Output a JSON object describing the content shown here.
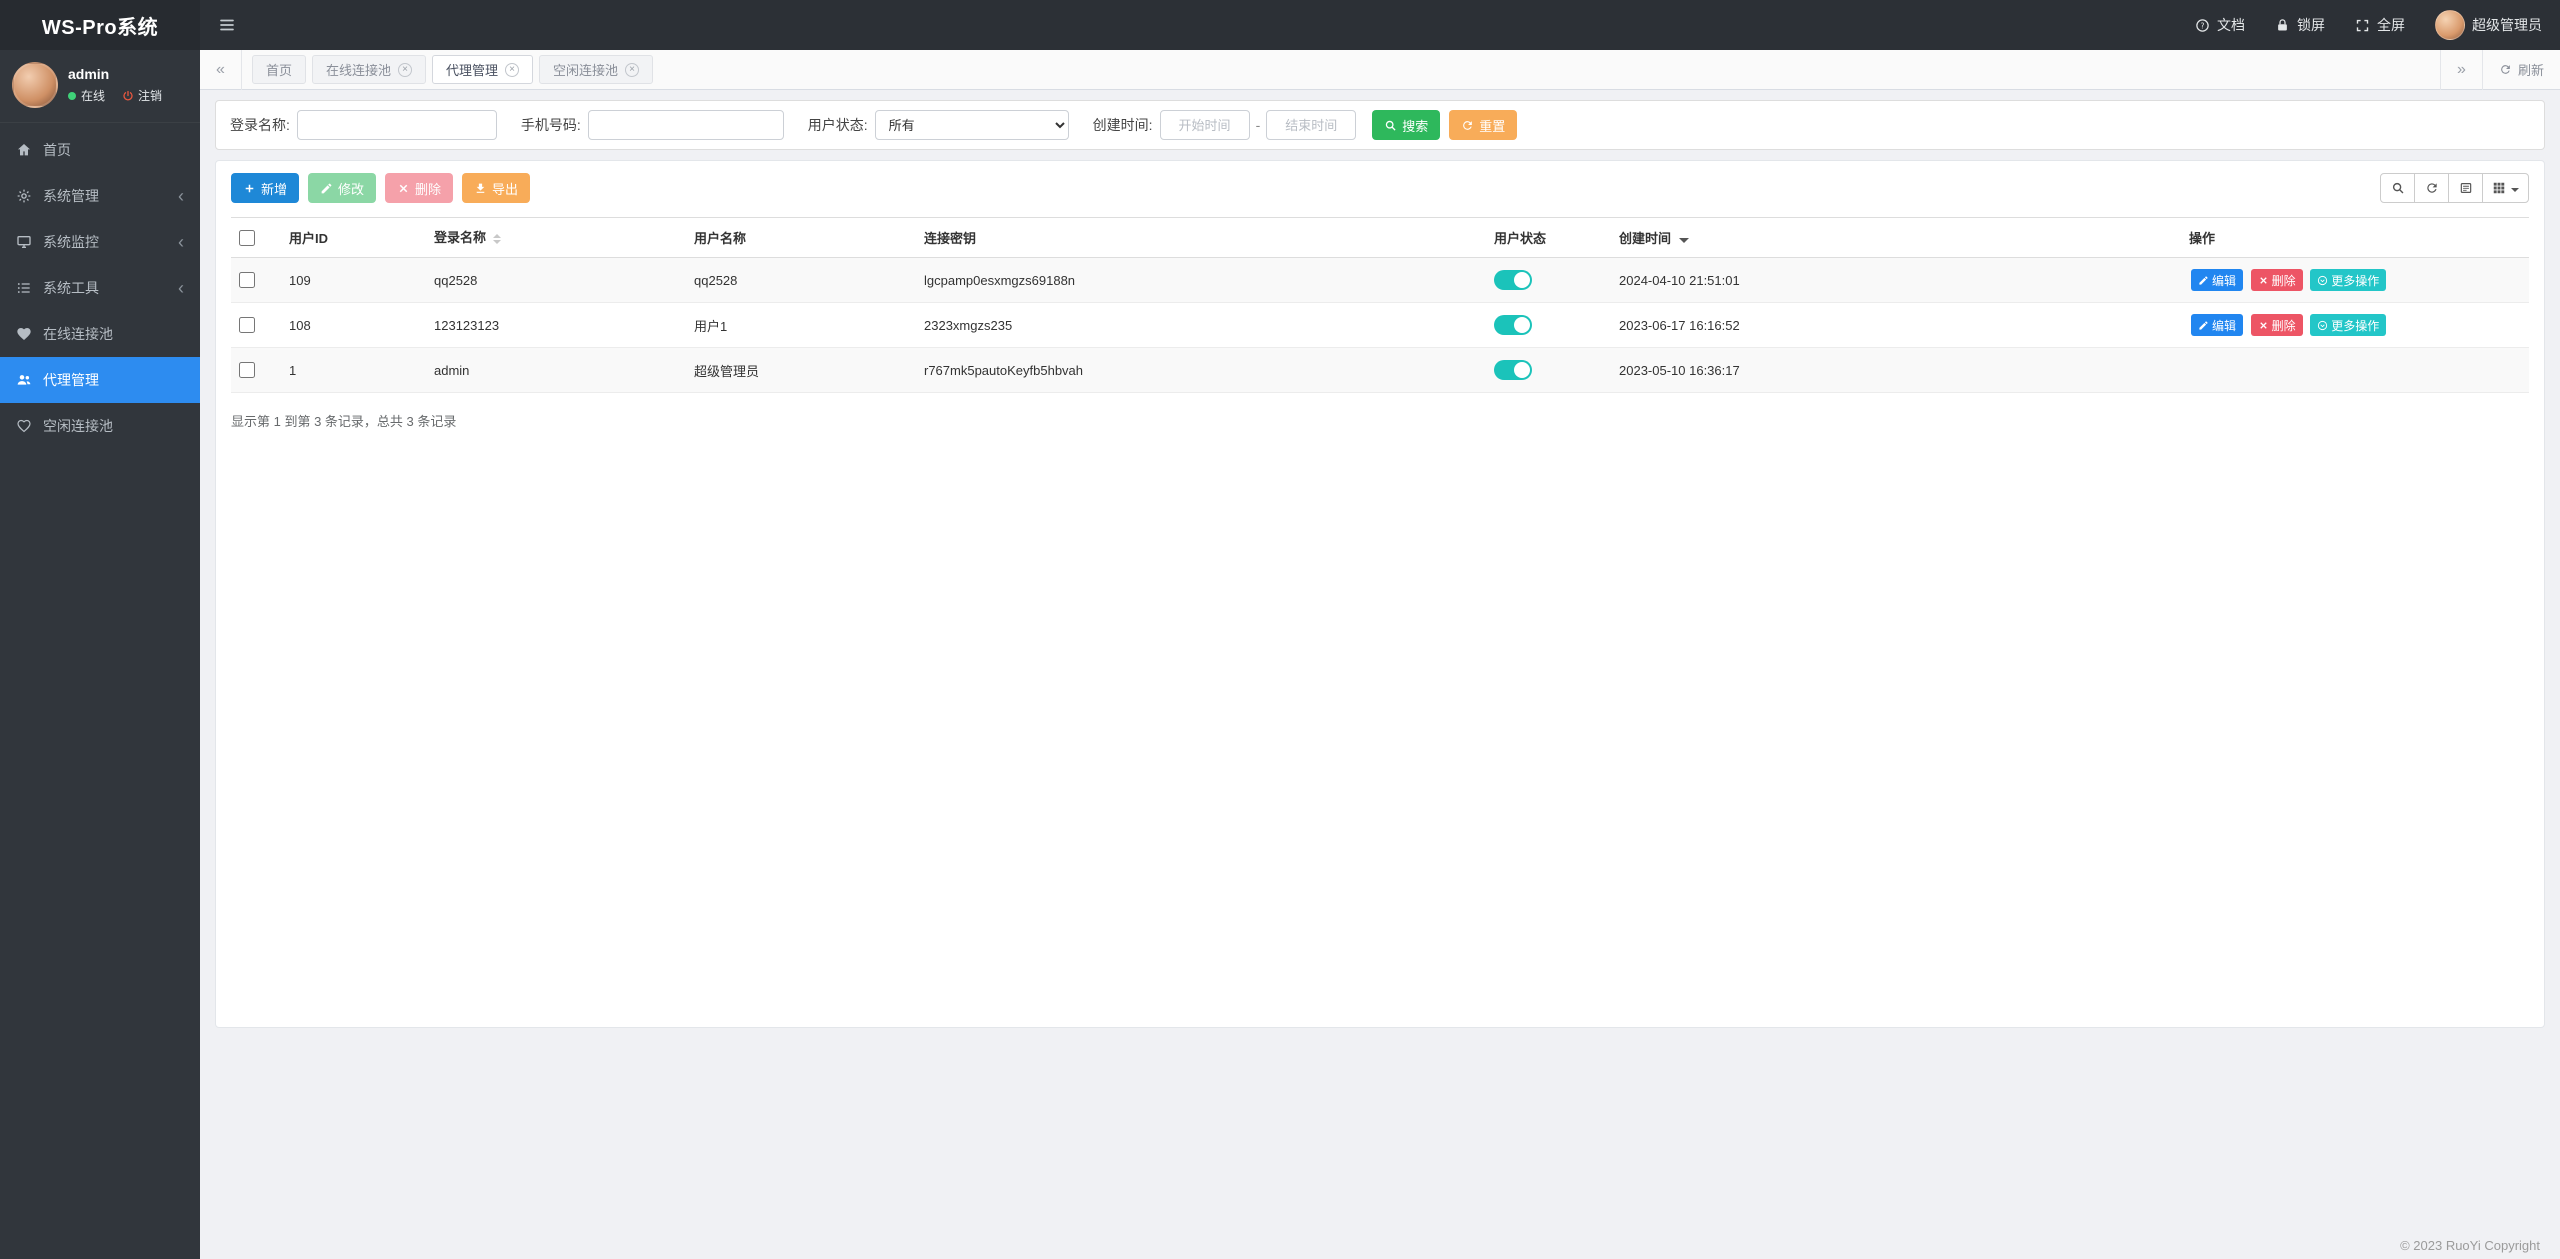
{
  "app": {
    "brand": "WS-Pro系统",
    "copyright": "© 2023 RuoYi Copyright"
  },
  "navbar": {
    "docs": "文档",
    "lock": "锁屏",
    "fullscreen": "全屏",
    "role": "超级管理员"
  },
  "sidebar": {
    "user": {
      "name": "admin",
      "online": "在线",
      "logout": "注销"
    },
    "items": [
      {
        "label": "首页"
      },
      {
        "label": "系统管理"
      },
      {
        "label": "系统监控"
      },
      {
        "label": "系统工具"
      },
      {
        "label": "在线连接池"
      },
      {
        "label": "代理管理"
      },
      {
        "label": "空闲连接池"
      }
    ]
  },
  "tabs": {
    "items": [
      {
        "label": "首页"
      },
      {
        "label": "在线连接池"
      },
      {
        "label": "代理管理"
      },
      {
        "label": "空闲连接池"
      }
    ],
    "refresh": "刷新"
  },
  "search": {
    "login_label": "登录名称:",
    "phone_label": "手机号码:",
    "status_label": "用户状态:",
    "status_value": "所有",
    "created_label": "创建时间:",
    "start_placeholder": "开始时间",
    "separator": "-",
    "end_placeholder": "结束时间",
    "search_btn": "搜索",
    "reset_btn": "重置"
  },
  "toolbar": {
    "add": "新增",
    "edit": "修改",
    "delete": "删除",
    "export": "导出"
  },
  "table": {
    "columns": {
      "id": "用户ID",
      "login": "登录名称",
      "name": "用户名称",
      "key": "连接密钥",
      "status": "用户状态",
      "created": "创建时间",
      "actions": "操作"
    },
    "rows": [
      {
        "id": "109",
        "login": "qq2528",
        "name": "qq2528",
        "key": "lgcpamp0esxmgzs69188n",
        "status": "on",
        "created": "2024-04-10 21:51:01"
      },
      {
        "id": "108",
        "login": "123123123",
        "name": "用户1",
        "key": "2323xmgzs235",
        "status": "on",
        "created": "2023-06-17 16:16:52"
      },
      {
        "id": "1",
        "login": "admin",
        "name": "超级管理员",
        "key": "r767mk5pautoKeyfb5hbvah",
        "status": "on",
        "created": "2023-05-10 16:36:17"
      }
    ],
    "row_actions": {
      "edit": "编辑",
      "delete": "删除",
      "more": "更多操作"
    },
    "summary": "显示第 1 到第 3 条记录，总共 3 条记录"
  },
  "colors": {
    "sidebar_active": "#2d8cf0",
    "btn_add": "#1e88d7",
    "btn_search_green": "#2eb85c",
    "btn_warning_orange": "#f8ac59",
    "btn_danger_red": "#ed5565",
    "btn_info_teal": "#23c6c8",
    "toggle_on_teal": "#1bc3ba"
  }
}
